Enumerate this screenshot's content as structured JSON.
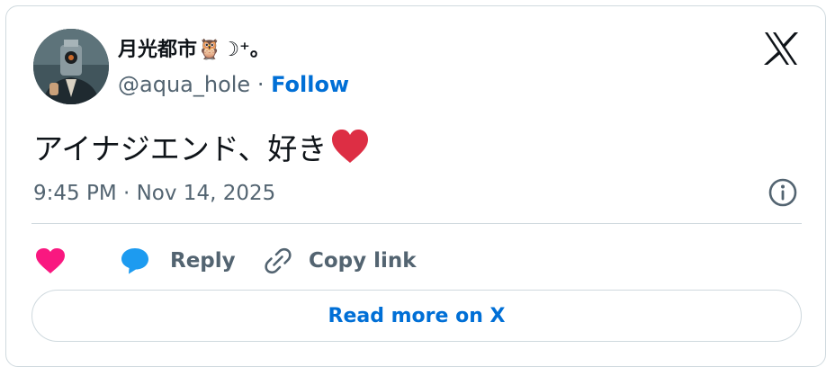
{
  "tweet": {
    "display_name": "月光都市🦉☽⁺。",
    "handle": "@aqua_hole",
    "separator": " · ",
    "follow_label": "Follow",
    "text": "アイナジエンド、好き",
    "text_emoji": "red-heart-emoji",
    "timestamp": "9:45 PM · Nov 14, 2025"
  },
  "actions": {
    "like_icon": "heart-icon",
    "reply_label": "Reply",
    "copy_link_label": "Copy link"
  },
  "read_more_label": "Read more on X",
  "colors": {
    "like": "#f91880",
    "reply": "#1d9bf0",
    "link": "#006fd6",
    "heart_emoji": "#dd2e44",
    "muted_text": "#536471"
  }
}
